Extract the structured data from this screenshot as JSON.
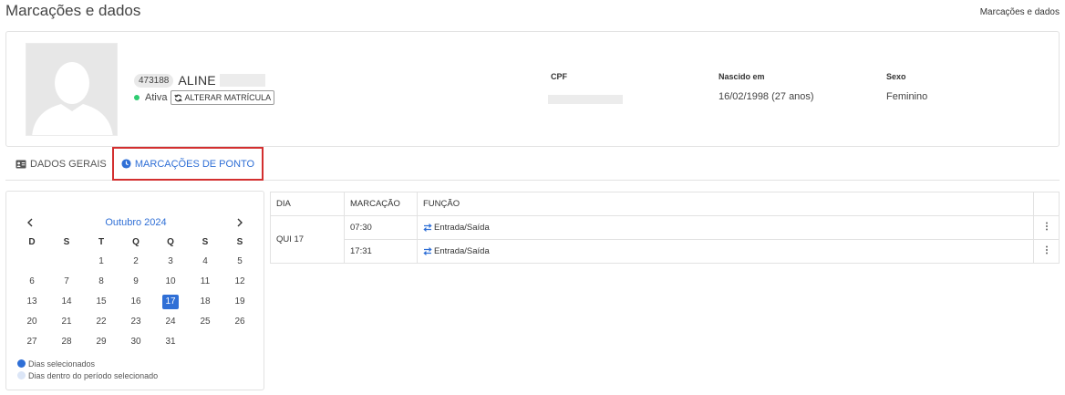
{
  "header": {
    "title": "Marcações e dados",
    "breadcrumb": "Marcações e dados"
  },
  "employee": {
    "id": "473188",
    "name": "ALINE",
    "status": "Ativa",
    "change_button": "ALTERAR MATRÍCULA",
    "cpf_label": "CPF",
    "birth_label": "Nascido em",
    "birth_value": "16/02/1998 (27 anos)",
    "sex_label": "Sexo",
    "sex_value": "Feminino"
  },
  "tabs": [
    {
      "label": "DADOS GERAIS",
      "icon": "id-card-icon"
    },
    {
      "label": "MARCAÇÕES DE PONTO",
      "icon": "clock-icon",
      "active": true
    }
  ],
  "calendar": {
    "month": "Outubro 2024",
    "weekdays": [
      "D",
      "S",
      "T",
      "Q",
      "Q",
      "S",
      "S"
    ],
    "weeks": [
      [
        "",
        "",
        "1",
        "2",
        "3",
        "4",
        "5"
      ],
      [
        "6",
        "7",
        "8",
        "9",
        "10",
        "11",
        "12"
      ],
      [
        "13",
        "14",
        "15",
        "16",
        "17",
        "18",
        "19"
      ],
      [
        "20",
        "21",
        "22",
        "23",
        "24",
        "25",
        "26"
      ],
      [
        "27",
        "28",
        "29",
        "30",
        "31",
        "",
        ""
      ]
    ],
    "selected_day": "17",
    "legend": [
      {
        "label": "Dias selecionados",
        "color": "#2f6fd6"
      },
      {
        "label": "Dias dentro do período selecionado",
        "color": "#dce6f7"
      }
    ]
  },
  "marks": {
    "columns": [
      "DIA",
      "MARCAÇÃO",
      "FUNÇÃO"
    ],
    "day": "QUI 17",
    "rows": [
      {
        "time": "07:30",
        "function": "Entrada/Saída"
      },
      {
        "time": "17:31",
        "function": "Entrada/Saída"
      }
    ]
  },
  "colors": {
    "accent": "#2f6fd6",
    "status_active": "#2ecc71",
    "highlight_border": "#d32f2f"
  }
}
